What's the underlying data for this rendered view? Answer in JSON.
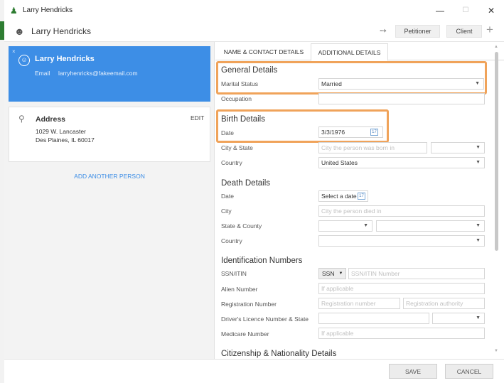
{
  "window": {
    "title": "Larry Hendricks",
    "minimize": "—",
    "maximize": "☐",
    "close": "✕"
  },
  "header": {
    "name": "Larry Hendricks",
    "petitioner_label": "Petitioner",
    "client_label": "Client",
    "add_symbol": "+"
  },
  "person_card": {
    "name": "Larry Hendricks",
    "email_label": "Email",
    "email_value": "larryhenricks@fakeemail.com",
    "close_symbol": "×"
  },
  "address_card": {
    "title": "Address",
    "edit_label": "EDIT",
    "line1": "1029 W. Lancaster",
    "line2": "Des Plaines, IL 60017"
  },
  "add_another_label": "ADD ANOTHER PERSON",
  "tabs": {
    "name_contact": "NAME & CONTACT DETAILS",
    "additional": "ADDITIONAL DETAILS"
  },
  "general": {
    "title": "General Details",
    "marital_label": "Marital Status",
    "marital_value": "Married",
    "occupation_label": "Occupation",
    "occupation_value": ""
  },
  "birth": {
    "title": "Birth Details",
    "date_label": "Date",
    "date_value": "3/3/1976",
    "city_state_label": "City & State",
    "city_placeholder": "City the person was born in",
    "country_label": "Country",
    "country_value": "United States"
  },
  "death": {
    "title": "Death Details",
    "date_label": "Date",
    "date_placeholder": "Select a date",
    "city_label": "City",
    "city_placeholder": "City the person died in",
    "state_county_label": "State & County",
    "country_label": "Country"
  },
  "identification": {
    "title": "Identification Numbers",
    "ssn_label": "SSN/ITIN",
    "ssn_type": "SSN",
    "ssn_placeholder": "SSN/ITIN Number",
    "alien_label": "Alien Number",
    "alien_placeholder": "If applicable",
    "registration_label": "Registration Number",
    "registration_placeholder": "Registration number",
    "authority_placeholder": "Registration authority",
    "licence_label": "Driver's Licence Number & State",
    "medicare_label": "Medicare Number",
    "medicare_placeholder": "If applicable"
  },
  "citizenship": {
    "title": "Citizenship & Nationality Details"
  },
  "footer": {
    "save_label": "SAVE",
    "cancel_label": "CANCEL"
  },
  "colors": {
    "accent_blue": "#3d8ee6",
    "highlight_orange": "#f0a35a",
    "app_green": "#2e7d32"
  }
}
